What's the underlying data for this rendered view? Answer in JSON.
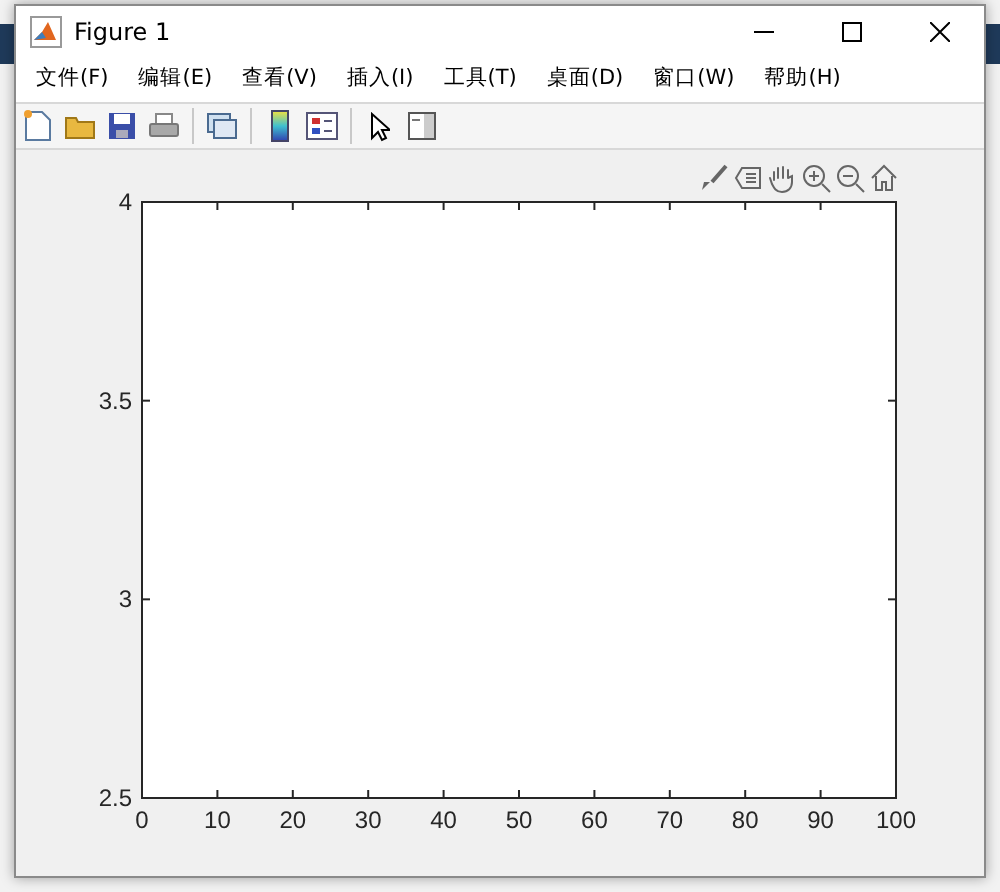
{
  "window": {
    "title": "Figure 1"
  },
  "menu": [
    "文件(F)",
    "编辑(E)",
    "查看(V)",
    "插入(I)",
    "工具(T)",
    "桌面(D)",
    "窗口(W)",
    "帮助(H)"
  ],
  "figure": {
    "chart_data": {
      "type": "line",
      "xlim": [
        0,
        100
      ],
      "ylim": [
        2.5,
        4
      ],
      "xticks": [
        0,
        10,
        20,
        30,
        40,
        50,
        60,
        70,
        80,
        90,
        100
      ],
      "yticks": [
        2.5,
        3,
        {
          "value": 3.5,
          "label": "3.5"
        },
        4
      ]
    }
  }
}
